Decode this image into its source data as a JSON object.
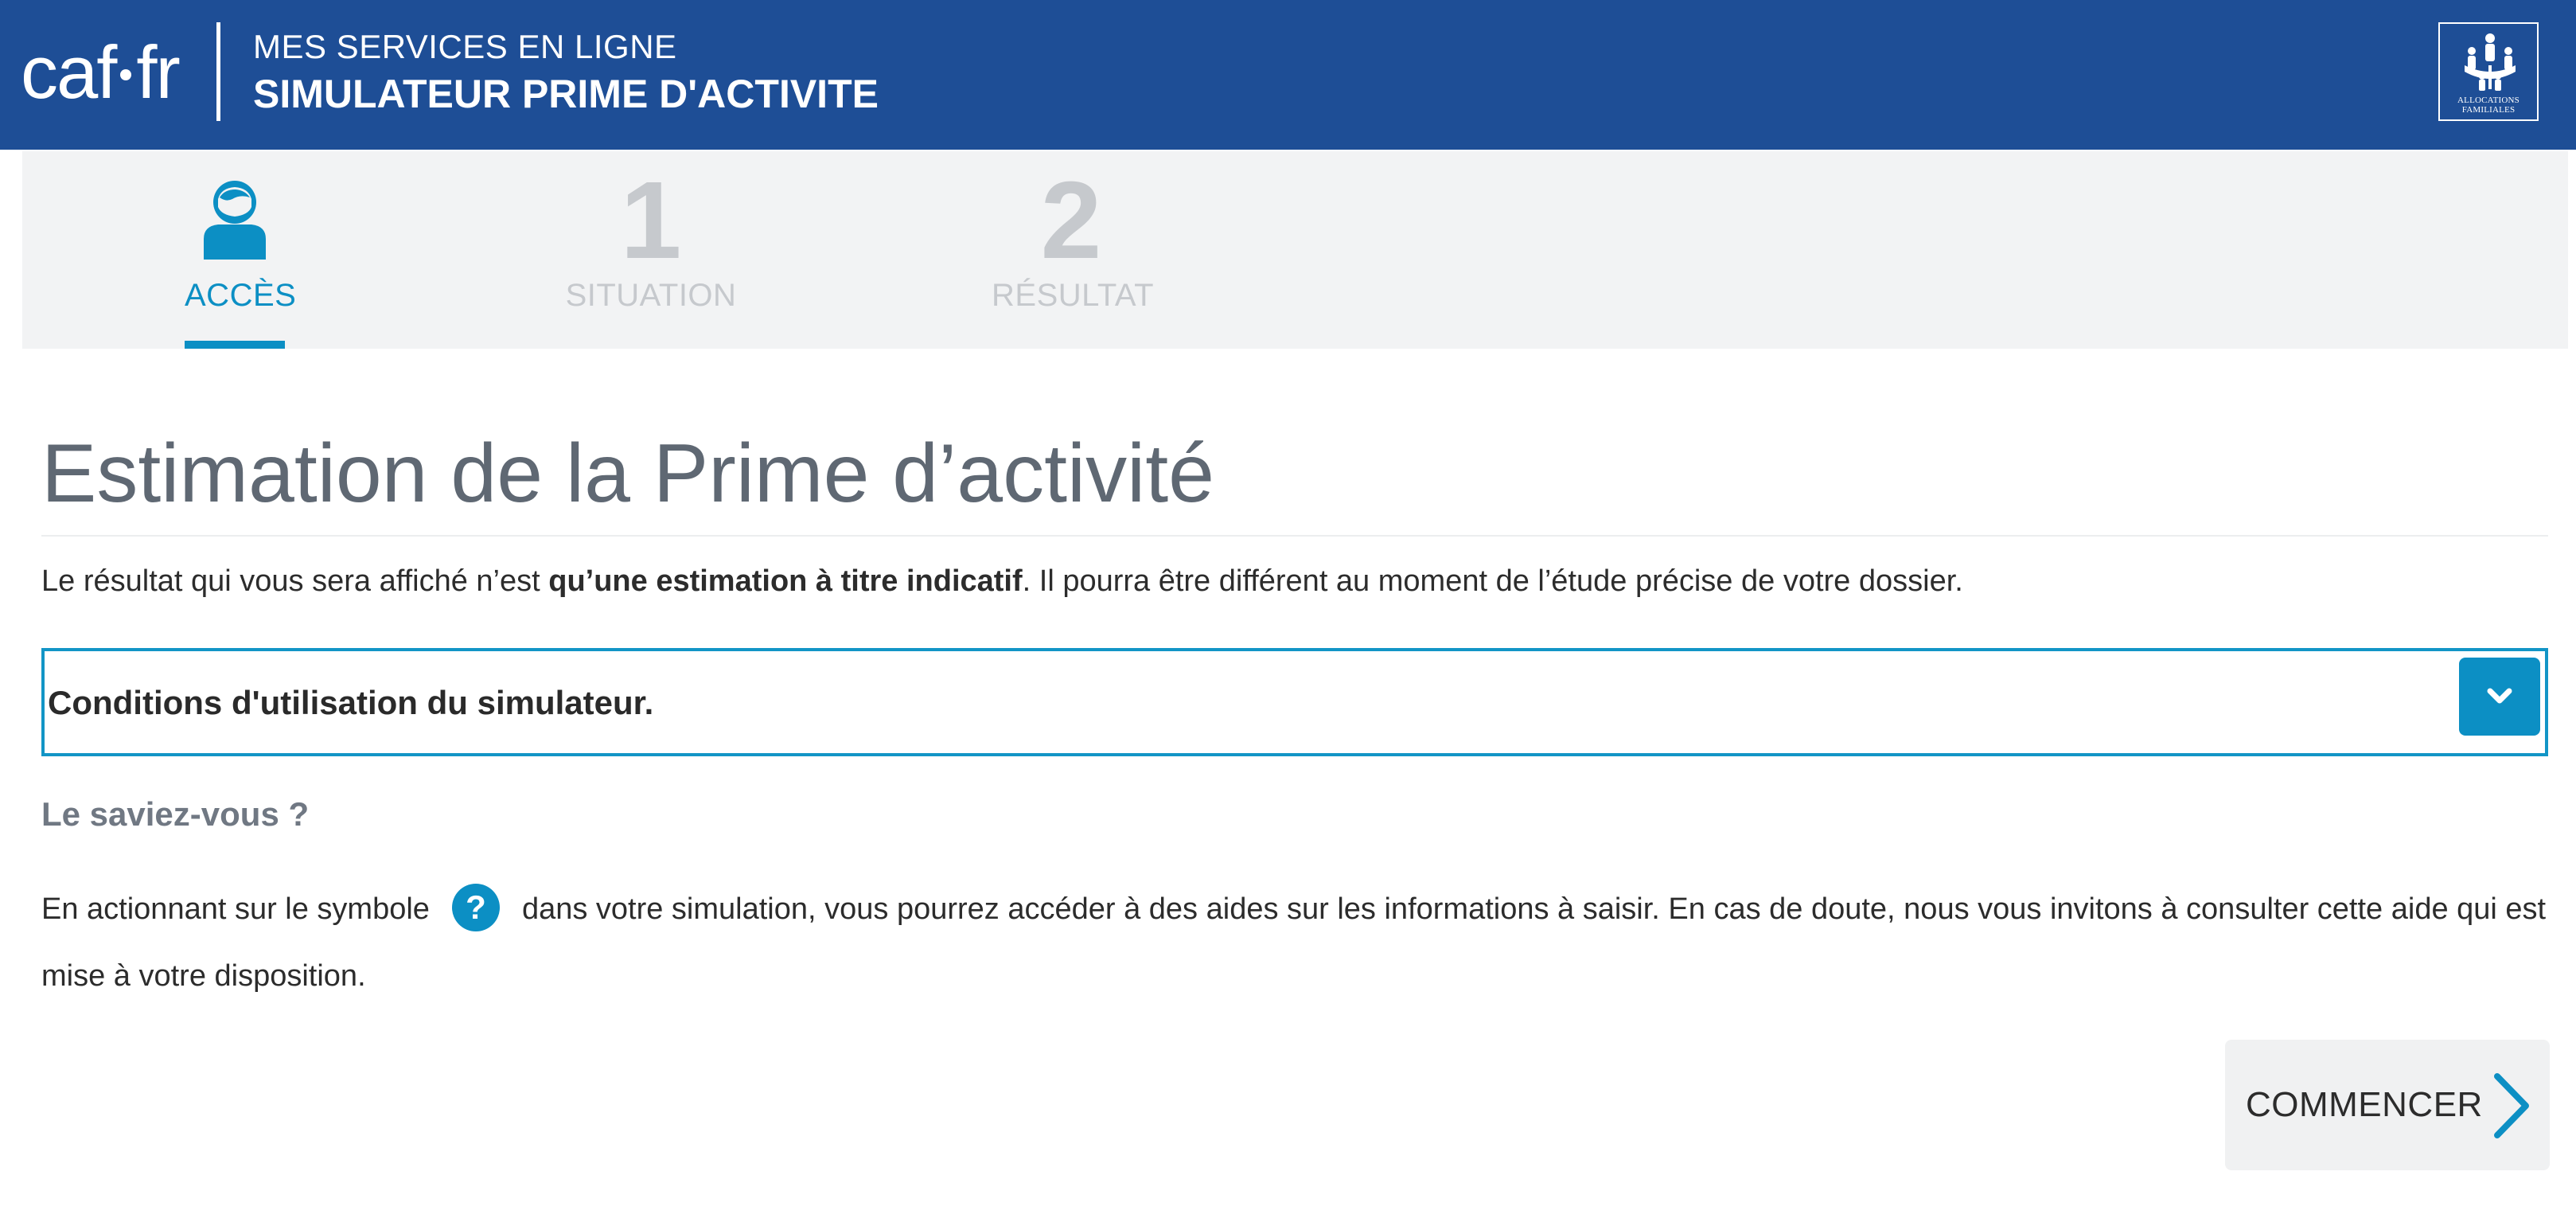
{
  "header": {
    "logo_left": "caf",
    "logo_right": "fr",
    "subtitle": "MES SERVICES EN LIGNE",
    "title": "SIMULATEUR PRIME D'ACTIVITE",
    "brand_badge_text": "ALLOCATIONS\nFAMILIALES",
    "colors": {
      "background": "#1e4e96",
      "text": "#ffffff"
    }
  },
  "steps": [
    {
      "number": "",
      "label": "ACCÈS",
      "icon": "user-icon",
      "active": true
    },
    {
      "number": "1",
      "label": "SITUATION",
      "active": false
    },
    {
      "number": "2",
      "label": "RÉSULTAT",
      "active": false
    }
  ],
  "main": {
    "title": "Estimation de la Prime d’activité",
    "intro": {
      "before": "Le résultat qui vous sera affiché n’est ",
      "bold": "qu’une estimation à titre indicatif",
      "after": ". Il pourra être différent au moment de l’étude précise de votre dossier."
    },
    "accordion": {
      "title": "Conditions d'utilisation du simulateur.",
      "toggle_icon": "chevron-down-icon",
      "expanded": false
    },
    "tip": {
      "heading": "Le saviez-vous ?",
      "text_before": "En actionnant sur le symbole",
      "icon_glyph": "?",
      "icon_name": "help-icon",
      "text_after": "dans votre simulation, vous pourrez accéder à des aides sur les informations à saisir. En cas de doute, nous vous invitons à consulter cette aide qui est mise à votre disposition."
    },
    "start_button": {
      "label": "COMMENCER",
      "icon": "chevron-right-icon"
    }
  },
  "colors": {
    "accent": "#0c8fc4",
    "title_gray": "#5f6873",
    "inactive_step": "#c6c9cd",
    "steps_background": "#f2f3f4"
  }
}
